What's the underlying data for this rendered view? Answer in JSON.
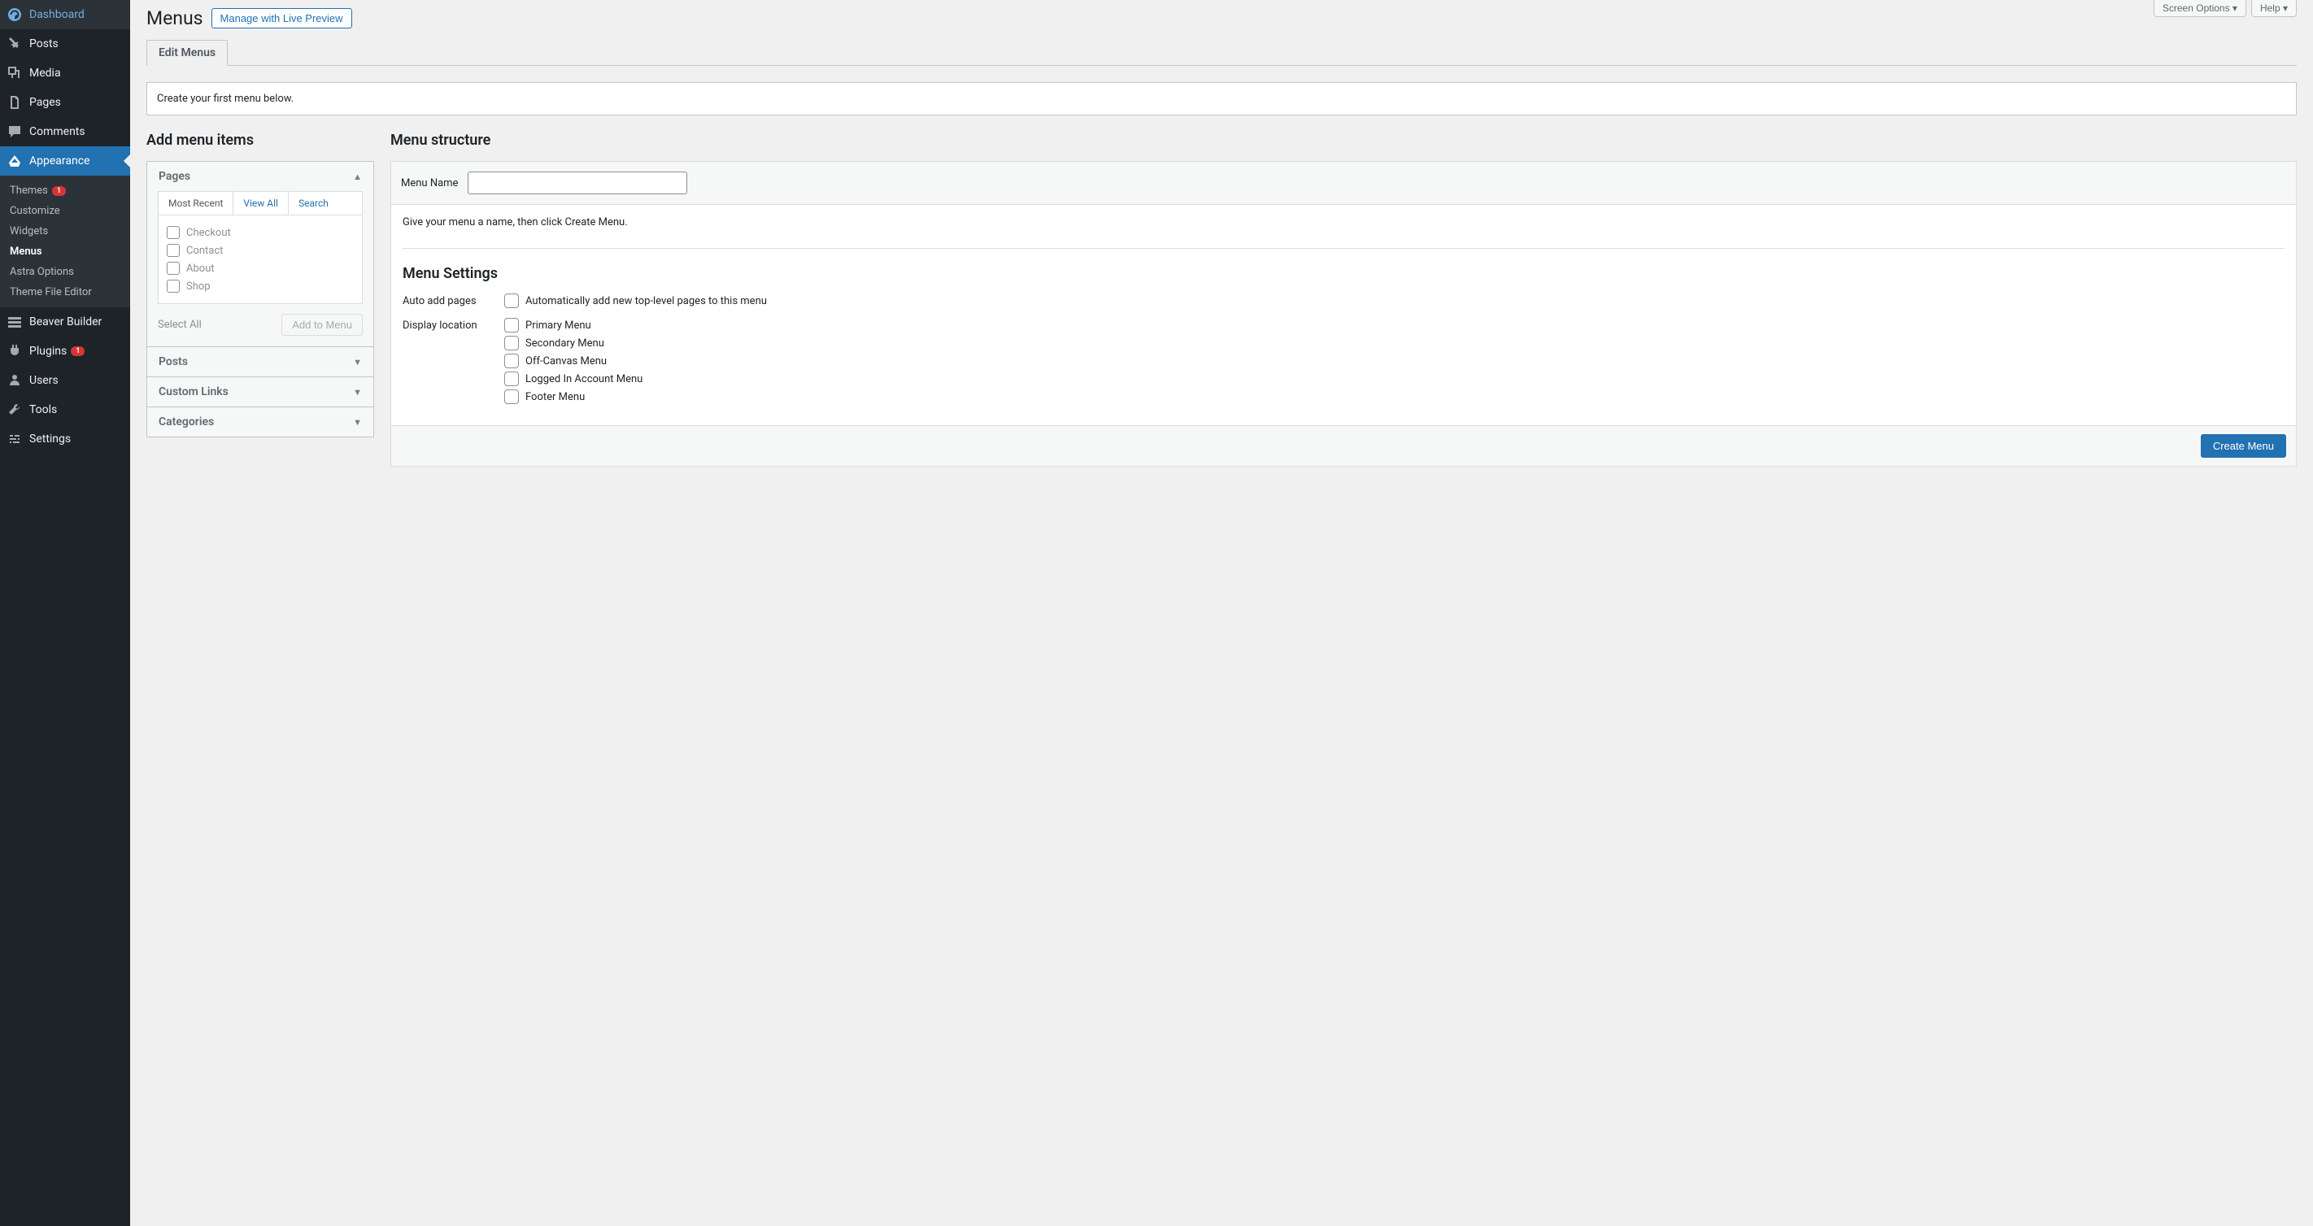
{
  "top_buttons": {
    "screen_options": "Screen Options",
    "help": "Help"
  },
  "page": {
    "title": "Menus",
    "action_button": "Manage with Live Preview",
    "tab": "Edit Menus",
    "notice": "Create your first menu below."
  },
  "sidebar": {
    "dashboard": "Dashboard",
    "posts": "Posts",
    "media": "Media",
    "pages": "Pages",
    "comments": "Comments",
    "appearance": "Appearance",
    "submenu": {
      "themes": "Themes",
      "themes_badge": "1",
      "customize": "Customize",
      "widgets": "Widgets",
      "menus": "Menus",
      "astra": "Astra Options",
      "editor": "Theme File Editor"
    },
    "beaver": "Beaver Builder",
    "plugins": "Plugins",
    "plugins_badge": "1",
    "users": "Users",
    "tools": "Tools",
    "settings": "Settings"
  },
  "left_col": {
    "header": "Add menu items",
    "pages_title": "Pages",
    "tabs": {
      "recent": "Most Recent",
      "view_all": "View All",
      "search": "Search"
    },
    "items": {
      "checkout": "Checkout",
      "contact": "Contact",
      "about": "About",
      "shop": "Shop"
    },
    "select_all": "Select All",
    "add_button": "Add to Menu",
    "posts_title": "Posts",
    "custom_links_title": "Custom Links",
    "categories_title": "Categories"
  },
  "right_col": {
    "header": "Menu structure",
    "name_label": "Menu Name",
    "instruction": "Give your menu a name, then click Create Menu.",
    "settings_title": "Menu Settings",
    "auto_add_label": "Auto add pages",
    "auto_add_option": "Automatically add new top-level pages to this menu",
    "display_label": "Display location",
    "locations": {
      "primary": "Primary Menu",
      "secondary": "Secondary Menu",
      "offcanvas": "Off-Canvas Menu",
      "loggedin": "Logged In Account Menu",
      "footer": "Footer Menu"
    },
    "create_button": "Create Menu"
  }
}
